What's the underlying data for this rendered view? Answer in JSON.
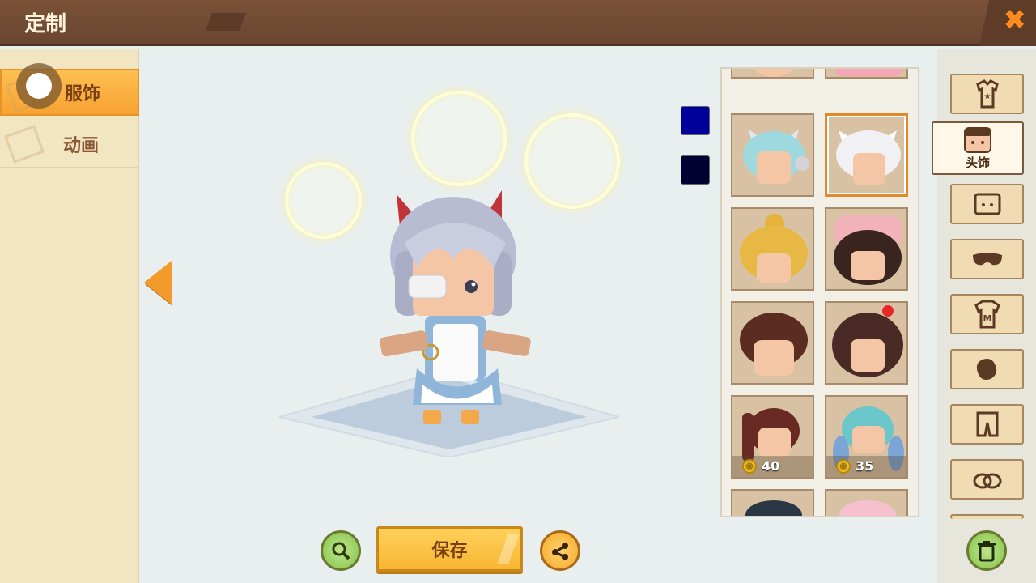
{
  "header": {
    "title": "定制",
    "close_icon": "close-icon"
  },
  "left_tabs": [
    {
      "label": "服饰",
      "active": true
    },
    {
      "label": "动画",
      "active": false
    }
  ],
  "stage": {
    "nav_icon": "arrow-left-icon",
    "color_swatches": [
      "#00009a",
      "#000033"
    ]
  },
  "items": [
    {
      "name": "cat-ear-headphones-hair",
      "price": null,
      "selected": false
    },
    {
      "name": "white-cat-ear-hair",
      "price": null,
      "selected": true
    },
    {
      "name": "blonde-bun-hair",
      "price": null,
      "selected": false
    },
    {
      "name": "pig-hood-hair",
      "price": null,
      "selected": false
    },
    {
      "name": "brown-swept-hair",
      "price": null,
      "selected": false
    },
    {
      "name": "heart-bow-hair",
      "price": null,
      "selected": false
    },
    {
      "name": "red-ponytail-hair",
      "price": "40",
      "selected": false
    },
    {
      "name": "teal-twintail-hair",
      "price": "35",
      "selected": false
    }
  ],
  "categories": [
    {
      "icon": "outfit-icon",
      "label": ""
    },
    {
      "icon": "face-hair-icon",
      "label": "头饰",
      "active": true
    },
    {
      "icon": "face-icon",
      "label": ""
    },
    {
      "icon": "mask-icon",
      "label": ""
    },
    {
      "icon": "shirt-icon",
      "label": ""
    },
    {
      "icon": "gloves-icon",
      "label": ""
    },
    {
      "icon": "pants-icon",
      "label": ""
    },
    {
      "icon": "shoes-icon",
      "label": ""
    }
  ],
  "footer": {
    "save_label": "保存",
    "zoom_icon": "magnifier-icon",
    "share_icon": "share-icon",
    "trash_icon": "trash-icon"
  },
  "colors": {
    "accent": "#f7b632",
    "header_bg": "#6e4832",
    "panel_bg": "#f1e6c1"
  }
}
